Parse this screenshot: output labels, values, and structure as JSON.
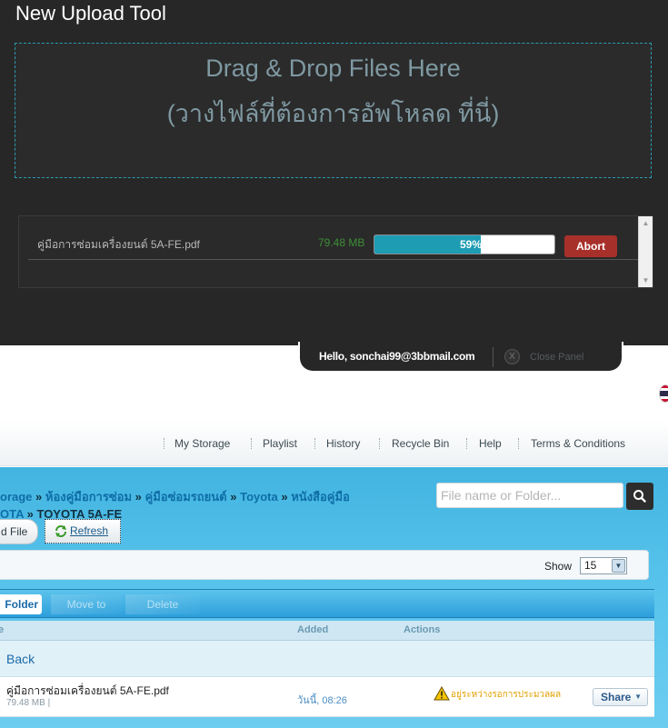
{
  "upload": {
    "title": "New Upload Tool",
    "dropzone_line1": "Drag & Drop Files Here",
    "dropzone_line2": "(วางไฟล์ที่ต้องการอัพโหลด ที่นี่)",
    "queue": {
      "filename": "คู่มือการซ่อมเครื่องยนต์ 5A-FE.pdf",
      "size": "79.48 MB",
      "progress_percent": 59,
      "progress_label": "59%",
      "abort_label": "Abort"
    }
  },
  "session": {
    "hello": "Hello, sonchai99@3bbmail.com",
    "close_x": "X",
    "close_panel": "Close Panel"
  },
  "nav": {
    "items": [
      "My Storage",
      "Playlist",
      "History",
      "Recycle Bin",
      "Help",
      "Terms & Conditions"
    ]
  },
  "breadcrumb": {
    "line1": [
      "orage",
      "ห้องคู่มือการซ่อม",
      "คู่มือซ่อมรถยนต์",
      "Toyota",
      "หนังสือคู่มือ"
    ],
    "line2_link": "OTA",
    "current": "TOYOTA 5A-FE",
    "separator": "»"
  },
  "search": {
    "placeholder": "File name or Folder..."
  },
  "actions": {
    "upload_file": "d File",
    "refresh": "Refresh"
  },
  "pager": {
    "show_label": "Show",
    "show_value": "15"
  },
  "toolbar": {
    "new_folder": "Folder",
    "move_to": "Move to",
    "delete": "Delete"
  },
  "table": {
    "columns": {
      "name": "e",
      "added": "Added",
      "actions": "Actions"
    },
    "back_label": "Back",
    "rows": [
      {
        "name": "คู่มือการซ่อมเครื่องยนต์ 5A-FE.pdf",
        "size": "79.48 MB |",
        "added": "วันนี้, 08:26",
        "status": "อยู่ระหว่างรอการประมวลผล",
        "share": "Share"
      }
    ]
  },
  "colors": {
    "accent_blue": "#42b4e0",
    "progress_teal": "#1e9cb4",
    "abort_red": "#a8302a",
    "warning_orange": "#e0a000"
  },
  "icons": [
    "search-icon",
    "refresh-icon",
    "warning-icon",
    "close-icon",
    "thai-flag-icon",
    "caret-down-icon"
  ]
}
